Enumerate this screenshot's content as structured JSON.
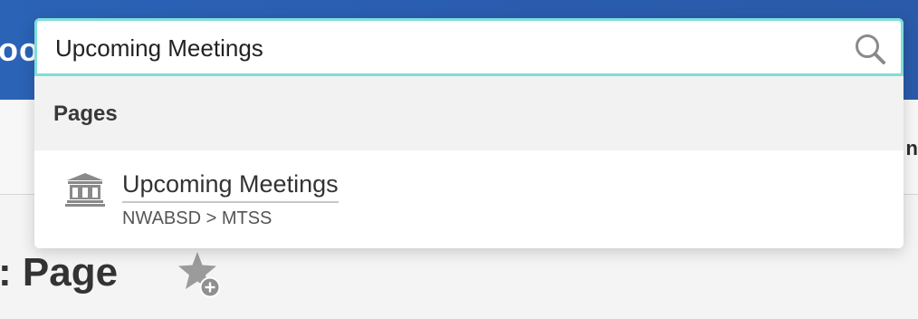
{
  "background": {
    "brand_fragment": "oo",
    "subheader_fragment": "n",
    "page_title_fragment": ": Page",
    "favorite_icon": "star-plus-icon"
  },
  "search": {
    "value": "Upcoming Meetings",
    "placeholder": "",
    "icon": "search-icon",
    "focus_color": "#7fded8"
  },
  "results": {
    "groups": [
      {
        "label": "Pages",
        "items": [
          {
            "title": "Upcoming Meetings",
            "path": "NWABSD > MTSS",
            "icon": "building-icon"
          }
        ]
      }
    ]
  },
  "colors": {
    "header_blue": "#2b63b6",
    "panel_bg": "#ffffff",
    "group_bg": "#f1f2f1"
  }
}
